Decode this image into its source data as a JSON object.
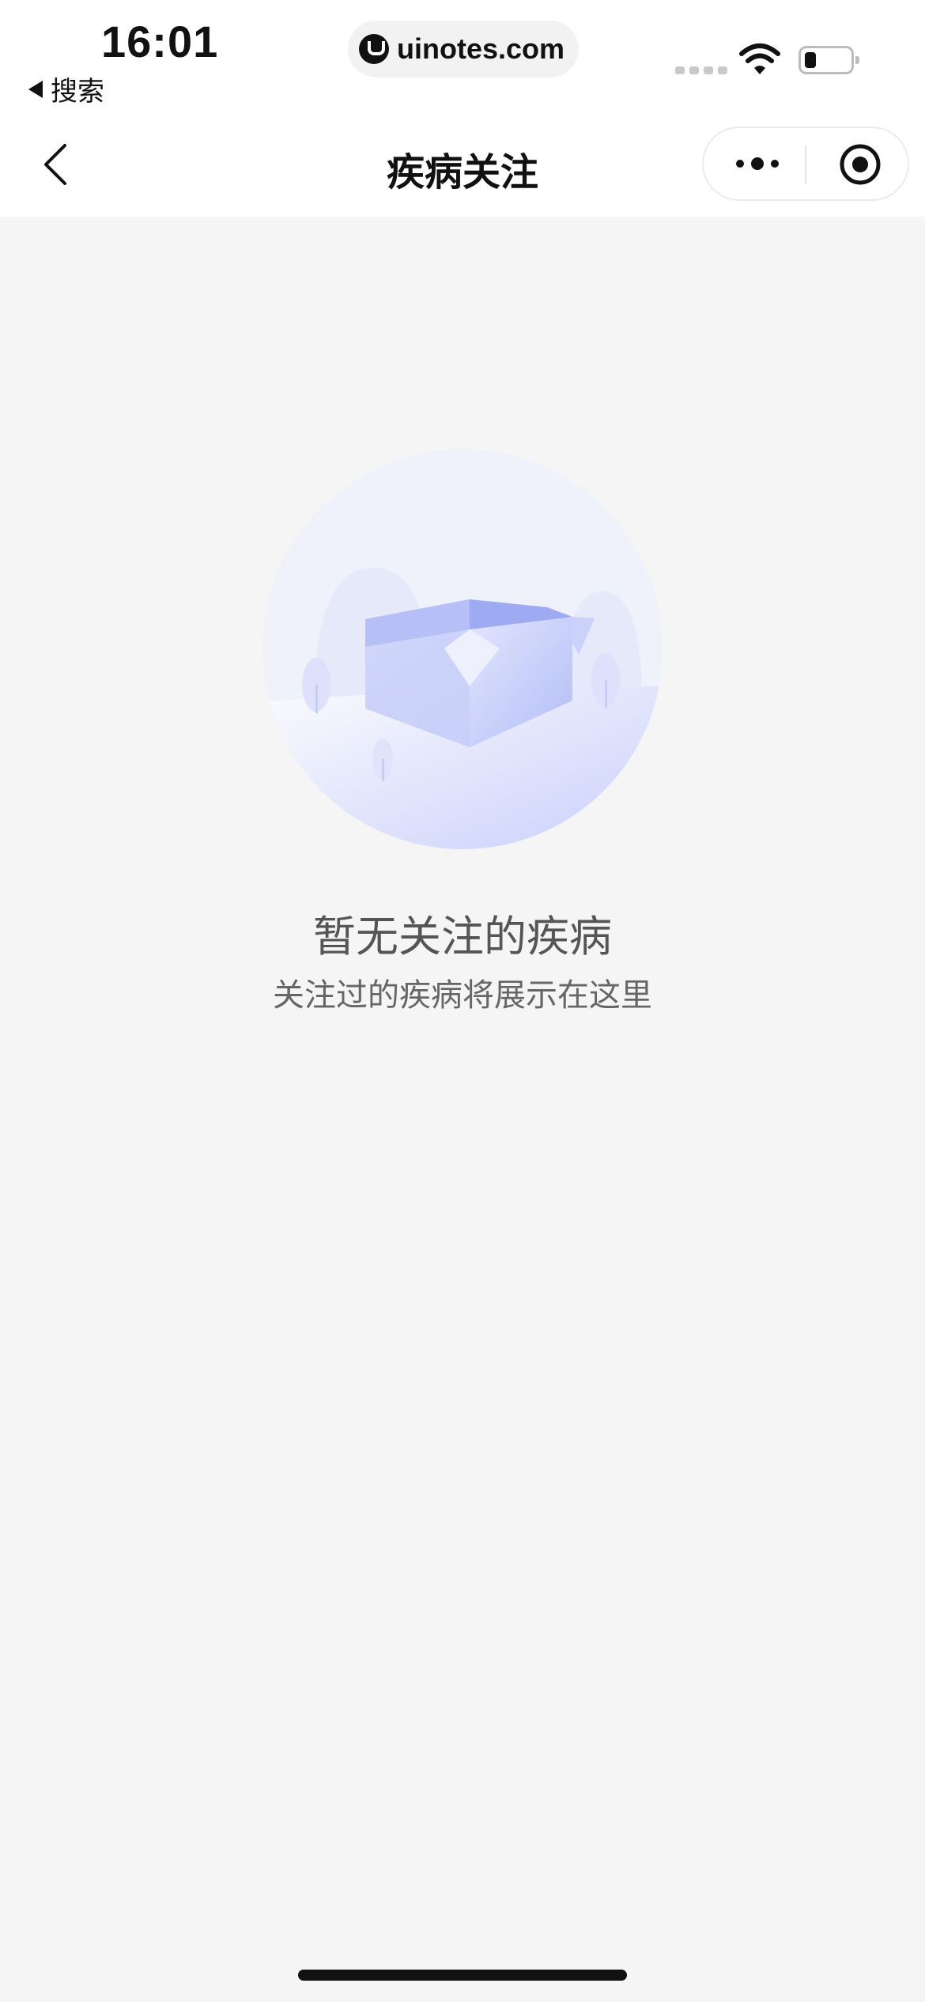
{
  "status_bar": {
    "time": "16:01",
    "back_app_label": "搜索",
    "url": "uinotes.com"
  },
  "nav": {
    "title": "疾病关注"
  },
  "empty_state": {
    "title": "暂无关注的疾病",
    "subtitle": "关注过的疾病将展示在这里"
  },
  "icons": {
    "back": "chevron-left-icon",
    "more": "more-dots-icon",
    "close": "target-circle-icon"
  },
  "colors": {
    "background": "#f5f5f5",
    "illustration_accent": "#a9b4f5"
  }
}
